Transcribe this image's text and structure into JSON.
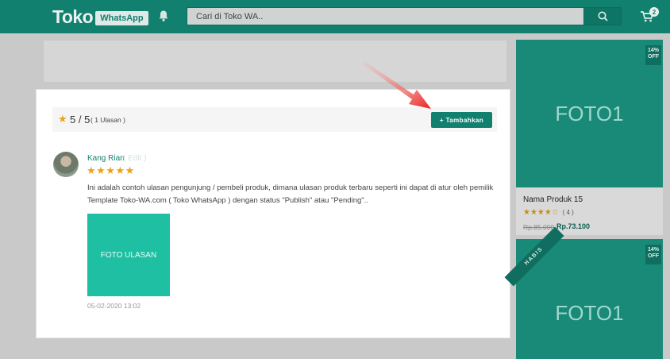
{
  "header": {
    "logo_text": "Toko",
    "logo_badge": "WhatsApp",
    "search_placeholder": "Cari di Toko WA..",
    "cart_count": "2"
  },
  "modal": {
    "rating_score": "5 / 5",
    "rating_count": "( 1 Ulasan )",
    "add_button_label": "+ Tambahkan",
    "review": {
      "name": "Kang Rian",
      "edit_label": "( Edit )",
      "stars": "★★★★★",
      "text": "Ini adalah contoh ulasan pengunjung / pembeli produk, dimana ulasan produk terbaru seperti ini dapat di atur oleh pemilik Template Toko-WA.com ( Toko WhatsApp ) dengan status \"Publish\" atau \"Pending\"..",
      "photo_label": "FOTO ULASAN",
      "date": "05-02-2020 13:02"
    }
  },
  "products": [
    {
      "image_label": "FOTO1",
      "discount": "14% OFF",
      "name": "Nama Produk 15",
      "stars": "★★★★☆",
      "rating_count": "( 4 )",
      "price_old": "Rp.85.000",
      "price_new": "Rp.73.100"
    },
    {
      "image_label": "FOTO1",
      "discount": "14% OFF",
      "ribbon": "HABIS"
    }
  ],
  "colors": {
    "brand": "#11806e",
    "star": "#e9a21b",
    "photo": "#1fbfa3",
    "arrow": "#e8231f"
  }
}
